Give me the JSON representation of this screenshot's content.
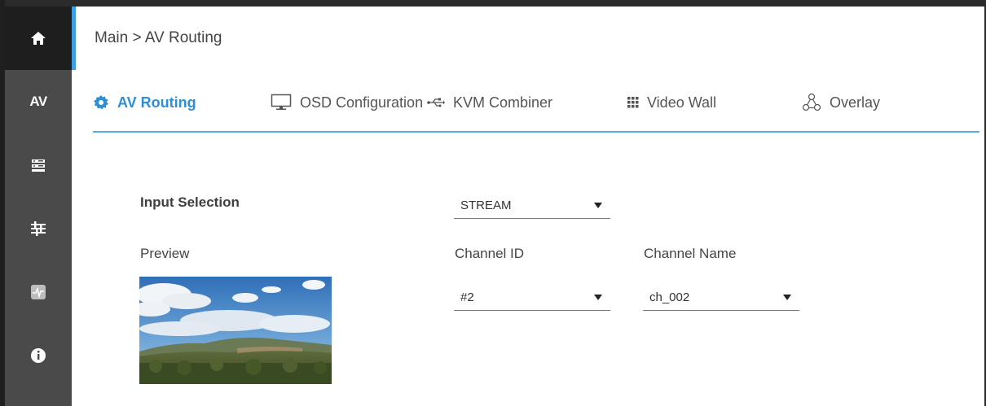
{
  "sidebar": {
    "items": [
      {
        "icon": "home-icon"
      },
      {
        "label": "AV"
      },
      {
        "icon": "server-icon"
      },
      {
        "icon": "sliders-icon"
      },
      {
        "icon": "monitor-pulse-icon"
      },
      {
        "icon": "info-icon"
      }
    ]
  },
  "breadcrumb": "Main > AV Routing",
  "tabs": [
    {
      "label": "AV Routing",
      "icon": "gear-icon"
    },
    {
      "label": "OSD Configuration",
      "icon": "monitor-icon"
    },
    {
      "label": "KVM Combiner",
      "icon": "usb-icon"
    },
    {
      "label": "Video Wall",
      "icon": "grid-icon"
    },
    {
      "label": "Overlay",
      "icon": "overlay-icon"
    }
  ],
  "form": {
    "input_selection_label": "Input Selection",
    "input_selection_value": "STREAM",
    "preview_label": "Preview",
    "channel_id_label": "Channel ID",
    "channel_id_value": "#2",
    "channel_name_label": "Channel Name",
    "channel_name_value": "ch_002"
  },
  "colors": {
    "accent": "#2d8fd5",
    "sidebar": "#4a4a4a",
    "sidebar_active": "#1e1e1e"
  }
}
